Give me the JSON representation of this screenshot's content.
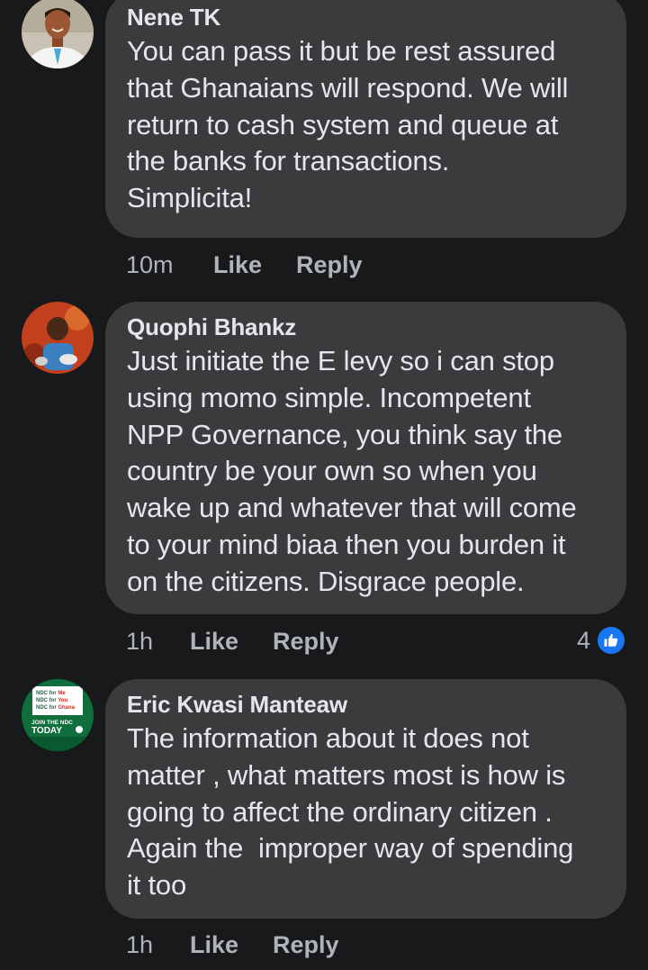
{
  "comments": [
    {
      "author": "Nene TK",
      "text": "You can pass it but be rest assured\nthat Ghanaians will respond. We will\nreturn to cash system and queue at\nthe banks for transactions.\nSimplicita!",
      "time": "10m",
      "like_label": "Like",
      "reply_label": "Reply"
    },
    {
      "author": "Quophi Bhankz",
      "text": "Just initiate the E levy so i can stop\nusing momo simple. Incompetent\nNPP Governance, you think say the\ncountry be your own so when you\nwake up and whatever that will come\nto your mind biaa then you burden it\non the citizens. Disgrace people.",
      "time": "1h",
      "like_label": "Like",
      "reply_label": "Reply",
      "reaction_count": "4",
      "reaction_icon": "thumbs-up-icon"
    },
    {
      "author": "Eric Kwasi Manteaw",
      "text": "The information about it does not\nmatter , what matters most is how is\ngoing to affect the ordinary citizen .\nAgain the  improper way of spending\nit too",
      "time": "1h",
      "like_label": "Like",
      "reply_label": "Reply",
      "avatar_text": {
        "line1a": "NDC for ",
        "line1b": "Me",
        "line2a": "NDC for ",
        "line2b": "You",
        "line3a": "NDC for ",
        "line3b": "Ghana",
        "join": "JOIN THE NDC",
        "today": "TODAY"
      }
    }
  ],
  "colors": {
    "background": "#18191a",
    "bubble": "#3a3b3c",
    "text": "#e4e6eb",
    "secondary": "#b0b3b8",
    "like_blue": "#1877f2"
  }
}
